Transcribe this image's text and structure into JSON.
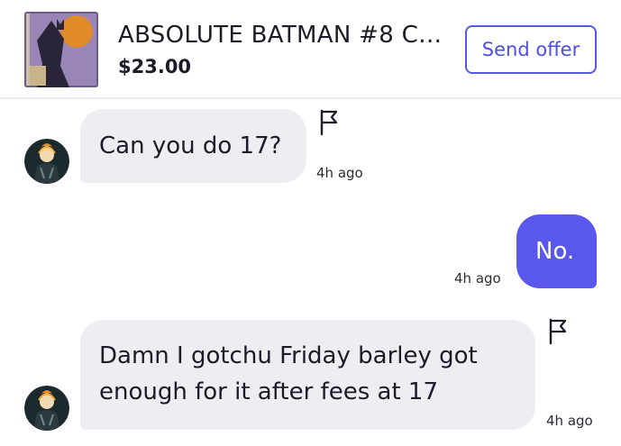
{
  "listing": {
    "title": "ABSOLUTE BATMAN #8 C…",
    "price": "$23.00",
    "send_offer_label": "Send offer",
    "thumbnail_icon": "comic-cover-thumbnail"
  },
  "messages": [
    {
      "direction": "incoming",
      "text": "Can you do 17?",
      "time": "4h ago"
    },
    {
      "direction": "outgoing",
      "text": "No.",
      "time": "4h ago"
    },
    {
      "direction": "incoming",
      "text_lines": [
        "Damn I gotchu Friday barley got",
        "enough for it after fees at 17"
      ],
      "time": "4h ago"
    }
  ],
  "icons": {
    "report": "flag-icon",
    "avatar": "avatar"
  },
  "colors": {
    "accent": "#5457e9",
    "outgoing_bubble": "#5a57ec",
    "incoming_bubble": "#ededf2"
  }
}
